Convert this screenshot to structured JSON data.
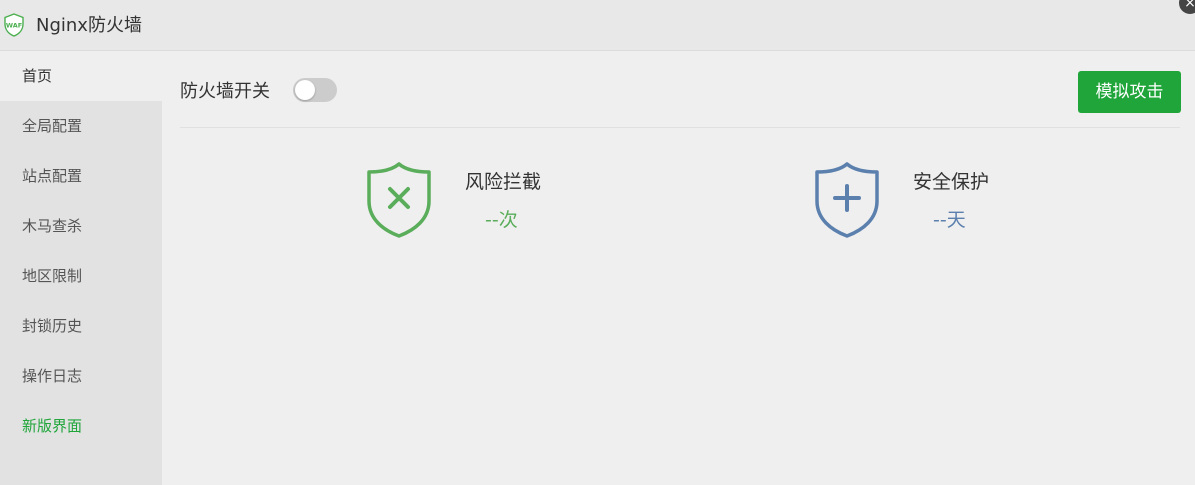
{
  "app": {
    "logo_text": "WAF",
    "title": "Nginx防火墙",
    "close_symbol": "×"
  },
  "sidebar": {
    "items": [
      {
        "label": "首页"
      },
      {
        "label": "全局配置"
      },
      {
        "label": "站点配置"
      },
      {
        "label": "木马查杀"
      },
      {
        "label": "地区限制"
      },
      {
        "label": "封锁历史"
      },
      {
        "label": "操作日志"
      },
      {
        "label": "新版界面"
      }
    ]
  },
  "toolbar": {
    "switch_label": "防火墙开关",
    "switch_on": false,
    "attack_button": "模拟攻击"
  },
  "stats": {
    "risk": {
      "title": "风险拦截",
      "value": "--次",
      "icon": "shield-x-icon"
    },
    "safe": {
      "title": "安全保护",
      "value": "--天",
      "icon": "shield-plus-icon"
    }
  },
  "colors": {
    "brand_green": "#20a53a",
    "risk_green": "#5aad5a",
    "safe_blue": "#5b80ad"
  }
}
